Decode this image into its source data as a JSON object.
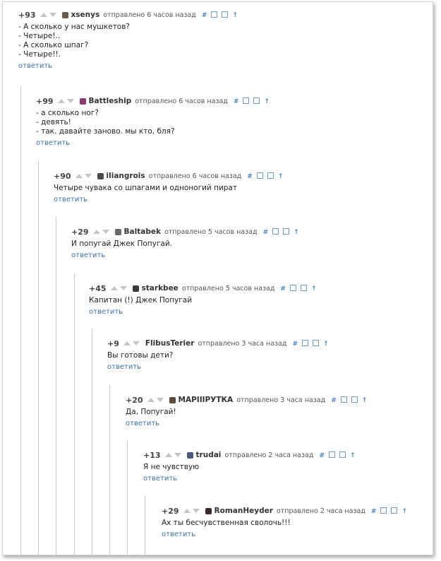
{
  "reply_label": "ответить",
  "tool_hash": "#",
  "tool_up": "↑",
  "comments": [
    {
      "rating": "+93",
      "user": "xsenys",
      "time": "отправлено 6 часов назад",
      "lines": [
        "- А сколько у нас мушкетов?",
        "- Четыре!..",
        "- А сколько шпаг?",
        "- Четыре!!."
      ],
      "avatar_color": "#6b5a4a"
    },
    {
      "rating": "+99",
      "user": "Battleship",
      "time": "отправлено 6 часов назад",
      "lines": [
        "- а сколько ног?",
        "- девять!",
        "- так. давайте заново. мы кто, бля?"
      ],
      "avatar_color": "#8a3a6a"
    },
    {
      "rating": "+90",
      "user": "iliangrois",
      "time": "отправлено 6 часов назад",
      "lines": [
        "Четыре чувака со шпагами и одноногий пират"
      ],
      "avatar_color": "#4a4a4a"
    },
    {
      "rating": "+29",
      "user": "Baltabek",
      "time": "отправлено 5 часов назад",
      "lines": [
        "И попугай Джек Попугай."
      ],
      "avatar_color": "#6a6a6a"
    },
    {
      "rating": "+45",
      "user": "starkbee",
      "time": "отправлено 5 часов назад",
      "lines": [
        "Капитан (!) Джек Попугай"
      ],
      "avatar_color": "#3a3a3a"
    },
    {
      "rating": "+9",
      "user": "FlibusTerier",
      "time": "отправлено 3 часа назад",
      "lines": [
        "Вы готовы дети?"
      ],
      "avatar_color": ""
    },
    {
      "rating": "+20",
      "user": "МАРIIIРУТКА",
      "time": "отправлено 3 часа назад",
      "lines": [
        "Да, Попугай!"
      ],
      "avatar_color": "#5a4a3a"
    },
    {
      "rating": "+13",
      "user": "trudai",
      "time": "отправлено 2 часа назад",
      "lines": [
        "Я не чувствую"
      ],
      "avatar_color": "#4a5a7a"
    },
    {
      "rating": "+29",
      "user": "RomanHeyder",
      "time": "отправлено 2 часа назад",
      "lines": [
        "Ах ты бесчувственная сволочь!!!"
      ],
      "avatar_color": "#3a2a2a"
    }
  ]
}
